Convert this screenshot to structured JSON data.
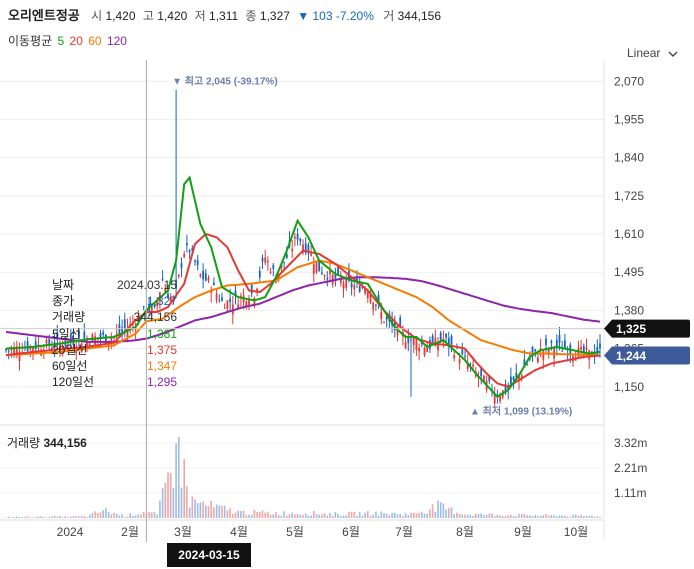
{
  "header": {
    "name": "오리엔트정공",
    "open_label": "시",
    "open": "1,420",
    "high_label": "고",
    "high": "1,420",
    "low_label": "저",
    "low": "1,311",
    "close_label": "종",
    "close": "1,327",
    "change": "▼ 103 -7.20%",
    "volume_label": "거",
    "volume": "344,156"
  },
  "ma_legend": {
    "title": "이동평균",
    "ma5": "5",
    "ma20": "20",
    "ma60": "60",
    "ma120": "120"
  },
  "scale_selector": {
    "label": "Linear",
    "icon": "chevron-down-icon"
  },
  "info_box": [
    {
      "label": "날짜",
      "value": "2024.03.15",
      "color": "#333333"
    },
    {
      "label": "종가",
      "value": "1,327",
      "color": "#1565c0"
    },
    {
      "label": "거래량",
      "value": "344,156",
      "color": "#333333"
    },
    {
      "label": "5일선",
      "value": "1,381",
      "color": "#10a010"
    },
    {
      "label": "20일선",
      "value": "1,375",
      "color": "#e53935"
    },
    {
      "label": "60일선",
      "value": "1,347",
      "color": "#f57c00"
    },
    {
      "label": "120일선",
      "value": "1,295",
      "color": "#8e24aa"
    }
  ],
  "volume_title": {
    "label": "거래량",
    "value": "344,156"
  },
  "crosshair_date": "2024-03-15",
  "colors": {
    "up": "#e53935",
    "down": "#1565c0",
    "ma5": "#10a010",
    "ma20": "#e53935",
    "ma60": "#f57c00",
    "ma120": "#8e24aa",
    "crosshair_tag": "#111111",
    "current_price_tag": "#111111",
    "ma_tag": "#3d5a99"
  },
  "chart_data": {
    "type": "candlestick",
    "price_axis": {
      "ticks": [
        "2,070",
        "1,955",
        "1,840",
        "1,725",
        "1,610",
        "1,495",
        "1,380",
        "1,265",
        "1,150"
      ],
      "range": [
        1080,
        2110
      ]
    },
    "volume_axis": {
      "ticks": [
        "3.32m",
        "2.21m",
        "1.11m"
      ],
      "range": [
        0,
        3.9
      ]
    },
    "x_axis": {
      "labels": [
        "2024",
        "2월",
        "3월",
        "4월",
        "5월",
        "6월",
        "7월",
        "8월",
        "9월",
        "10월"
      ]
    },
    "price_tags": [
      {
        "value": "1,325",
        "kind": "close"
      },
      {
        "value": "1,244",
        "kind": "ma"
      }
    ],
    "annotations": [
      {
        "text": "▼ 최고 2,045 (-39.17%)",
        "value": 2045
      },
      {
        "text": "▲ 최저 1,099 (13.19%)",
        "value": 1099
      }
    ],
    "anchors": {
      "close": [
        [
          0,
          1255
        ],
        [
          10,
          1275
        ],
        [
          20,
          1275
        ],
        [
          30,
          1300
        ],
        [
          40,
          1300
        ],
        [
          48,
          1360
        ],
        [
          52,
          1390
        ],
        [
          55,
          1350
        ],
        [
          58,
          1520
        ],
        [
          62,
          1320
        ],
        [
          65,
          1360
        ],
        [
          72,
          1330
        ],
        [
          82,
          1370
        ],
        [
          87,
          1420
        ],
        [
          92,
          1455
        ],
        [
          96,
          1660
        ],
        [
          100,
          1480
        ],
        [
          108,
          1560
        ],
        [
          116,
          1480
        ],
        [
          122,
          1460
        ],
        [
          128,
          1440
        ],
        [
          134,
          1440
        ],
        [
          140,
          1330
        ],
        [
          146,
          1310
        ],
        [
          152,
          1270
        ],
        [
          158,
          1275
        ],
        [
          162,
          1300
        ],
        [
          170,
          1230
        ],
        [
          176,
          1175
        ],
        [
          182,
          1135
        ],
        [
          186,
          1145
        ],
        [
          190,
          1180
        ],
        [
          194,
          1225
        ],
        [
          198,
          1255
        ],
        [
          204,
          1275
        ],
        [
          210,
          1255
        ],
        [
          216,
          1245
        ],
        [
          220,
          1255
        ]
      ],
      "ma5": [
        [
          0,
          1265
        ],
        [
          10,
          1270
        ],
        [
          20,
          1280
        ],
        [
          30,
          1293
        ],
        [
          40,
          1300
        ],
        [
          48,
          1330
        ],
        [
          52,
          1381
        ],
        [
          56,
          1410
        ],
        [
          60,
          1440
        ],
        [
          63,
          1530
        ],
        [
          66,
          1760
        ],
        [
          68,
          1780
        ],
        [
          72,
          1640
        ],
        [
          76,
          1570
        ],
        [
          80,
          1450
        ],
        [
          86,
          1420
        ],
        [
          92,
          1410
        ],
        [
          96,
          1420
        ],
        [
          100,
          1480
        ],
        [
          104,
          1560
        ],
        [
          108,
          1650
        ],
        [
          112,
          1600
        ],
        [
          116,
          1530
        ],
        [
          122,
          1490
        ],
        [
          128,
          1470
        ],
        [
          134,
          1460
        ],
        [
          140,
          1380
        ],
        [
          144,
          1330
        ],
        [
          148,
          1300
        ],
        [
          152,
          1300
        ],
        [
          156,
          1270
        ],
        [
          162,
          1290
        ],
        [
          166,
          1260
        ],
        [
          170,
          1230
        ],
        [
          174,
          1190
        ],
        [
          178,
          1155
        ],
        [
          182,
          1120
        ],
        [
          186,
          1140
        ],
        [
          190,
          1185
        ],
        [
          194,
          1240
        ],
        [
          198,
          1260
        ],
        [
          204,
          1270
        ],
        [
          210,
          1260
        ],
        [
          216,
          1250
        ],
        [
          220,
          1255
        ]
      ],
      "ma20": [
        [
          0,
          1245
        ],
        [
          10,
          1255
        ],
        [
          20,
          1263
        ],
        [
          30,
          1270
        ],
        [
          40,
          1283
        ],
        [
          48,
          1350
        ],
        [
          52,
          1375
        ],
        [
          56,
          1375
        ],
        [
          60,
          1390
        ],
        [
          66,
          1460
        ],
        [
          70,
          1580
        ],
        [
          74,
          1610
        ],
        [
          78,
          1600
        ],
        [
          82,
          1570
        ],
        [
          86,
          1500
        ],
        [
          90,
          1440
        ],
        [
          94,
          1435
        ],
        [
          98,
          1460
        ],
        [
          104,
          1510
        ],
        [
          110,
          1560
        ],
        [
          116,
          1550
        ],
        [
          122,
          1520
        ],
        [
          128,
          1480
        ],
        [
          134,
          1440
        ],
        [
          140,
          1380
        ],
        [
          146,
          1330
        ],
        [
          152,
          1295
        ],
        [
          158,
          1280
        ],
        [
          164,
          1275
        ],
        [
          170,
          1265
        ],
        [
          174,
          1225
        ],
        [
          178,
          1190
        ],
        [
          182,
          1160
        ],
        [
          186,
          1150
        ],
        [
          190,
          1170
        ],
        [
          196,
          1200
        ],
        [
          202,
          1220
        ],
        [
          208,
          1230
        ],
        [
          214,
          1240
        ],
        [
          220,
          1244
        ]
      ],
      "ma60": [
        [
          0,
          1245
        ],
        [
          10,
          1250
        ],
        [
          20,
          1255
        ],
        [
          30,
          1265
        ],
        [
          40,
          1275
        ],
        [
          48,
          1310
        ],
        [
          52,
          1347
        ],
        [
          58,
          1355
        ],
        [
          64,
          1390
        ],
        [
          70,
          1420
        ],
        [
          76,
          1440
        ],
        [
          82,
          1455
        ],
        [
          90,
          1460
        ],
        [
          100,
          1470
        ],
        [
          108,
          1510
        ],
        [
          116,
          1530
        ],
        [
          122,
          1520
        ],
        [
          128,
          1500
        ],
        [
          134,
          1480
        ],
        [
          140,
          1460
        ],
        [
          146,
          1440
        ],
        [
          152,
          1420
        ],
        [
          158,
          1390
        ],
        [
          164,
          1350
        ],
        [
          170,
          1320
        ],
        [
          176,
          1290
        ],
        [
          182,
          1275
        ],
        [
          188,
          1260
        ],
        [
          194,
          1250
        ],
        [
          200,
          1250
        ],
        [
          206,
          1248
        ],
        [
          212,
          1247
        ],
        [
          220,
          1244
        ]
      ],
      "ma120": [
        [
          0,
          1315
        ],
        [
          10,
          1305
        ],
        [
          20,
          1295
        ],
        [
          30,
          1285
        ],
        [
          40,
          1285
        ],
        [
          48,
          1290
        ],
        [
          52,
          1295
        ],
        [
          58,
          1310
        ],
        [
          64,
          1330
        ],
        [
          70,
          1350
        ],
        [
          76,
          1360
        ],
        [
          82,
          1375
        ],
        [
          88,
          1390
        ],
        [
          94,
          1400
        ],
        [
          100,
          1420
        ],
        [
          106,
          1440
        ],
        [
          112,
          1455
        ],
        [
          118,
          1465
        ],
        [
          124,
          1475
        ],
        [
          130,
          1480
        ],
        [
          136,
          1480
        ],
        [
          142,
          1478
        ],
        [
          148,
          1475
        ],
        [
          154,
          1468
        ],
        [
          160,
          1455
        ],
        [
          166,
          1440
        ],
        [
          172,
          1425
        ],
        [
          178,
          1410
        ],
        [
          184,
          1395
        ],
        [
          190,
          1385
        ],
        [
          196,
          1378
        ],
        [
          202,
          1372
        ],
        [
          208,
          1362
        ],
        [
          214,
          1352
        ],
        [
          220,
          1346
        ]
      ],
      "volume": [
        [
          0,
          0.05
        ],
        [
          30,
          0.08
        ],
        [
          36,
          0.4
        ],
        [
          40,
          0.25
        ],
        [
          44,
          0.1
        ],
        [
          52,
          0.34
        ],
        [
          56,
          0.15
        ],
        [
          63,
          3.32
        ],
        [
          66,
          2.4
        ],
        [
          68,
          0.9
        ],
        [
          76,
          0.6
        ],
        [
          86,
          0.3
        ],
        [
          100,
          0.25
        ],
        [
          112,
          0.25
        ],
        [
          124,
          0.2
        ],
        [
          136,
          0.25
        ],
        [
          150,
          0.2
        ],
        [
          160,
          0.6
        ],
        [
          170,
          0.2
        ],
        [
          190,
          0.15
        ],
        [
          220,
          0.1
        ]
      ]
    }
  }
}
